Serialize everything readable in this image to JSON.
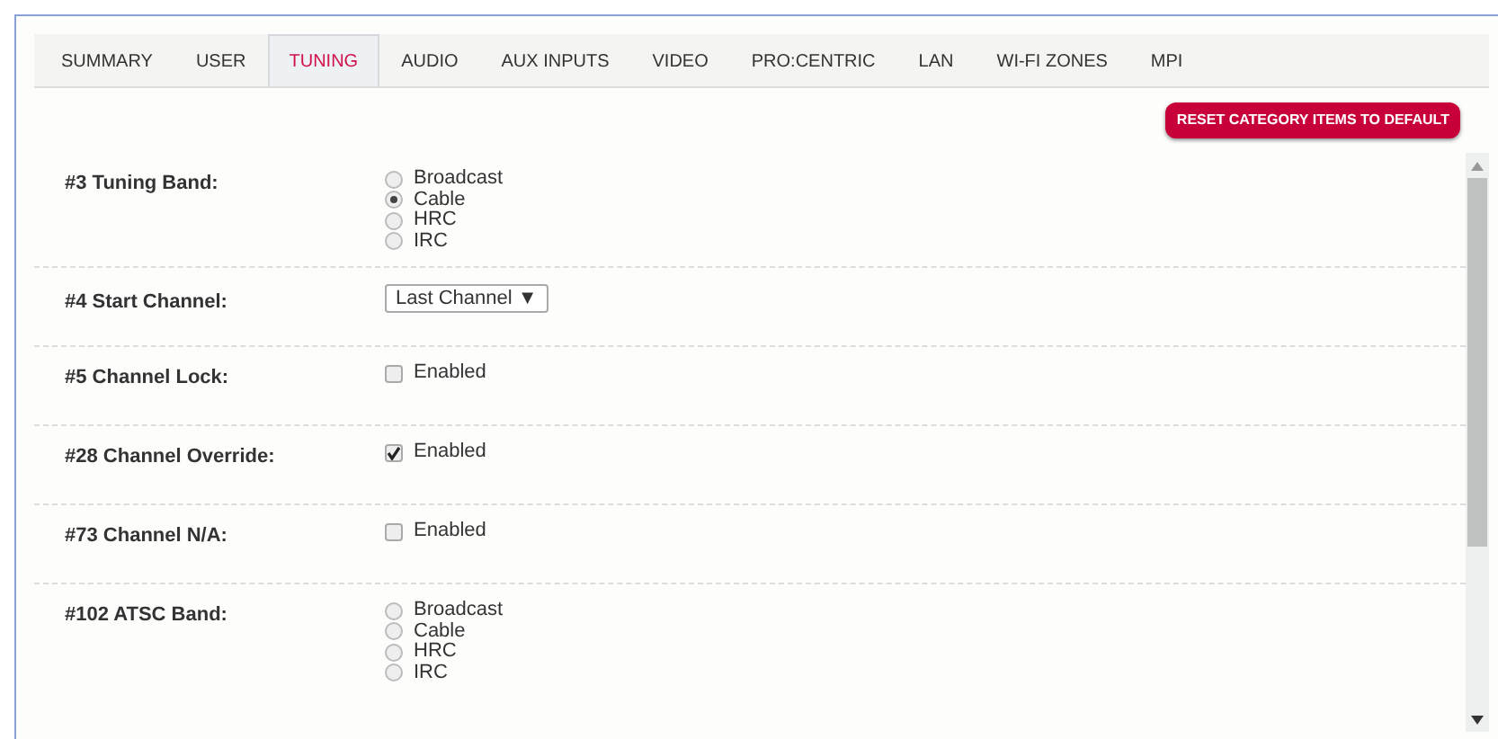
{
  "tabs": [
    {
      "label": "SUMMARY",
      "selected": false
    },
    {
      "label": "USER",
      "selected": false
    },
    {
      "label": "TUNING",
      "selected": true
    },
    {
      "label": "AUDIO",
      "selected": false
    },
    {
      "label": "AUX INPUTS",
      "selected": false
    },
    {
      "label": "VIDEO",
      "selected": false
    },
    {
      "label": "PRO:CENTRIC",
      "selected": false
    },
    {
      "label": "LAN",
      "selected": false
    },
    {
      "label": "WI-FI ZONES",
      "selected": false
    },
    {
      "label": "MPI",
      "selected": false
    }
  ],
  "reset_button": "RESET CATEGORY ITEMS TO DEFAULT",
  "settings": [
    {
      "kind": "radio",
      "label": "#3 Tuning Band:",
      "options": [
        {
          "label": "Broadcast",
          "selected": false
        },
        {
          "label": "Cable",
          "selected": true
        },
        {
          "label": "HRC",
          "selected": false
        },
        {
          "label": "IRC",
          "selected": false
        }
      ]
    },
    {
      "kind": "select",
      "label": "#4 Start Channel:",
      "value": "Last Channel ▼"
    },
    {
      "kind": "checkbox",
      "label": "#5 Channel Lock:",
      "text": "Enabled",
      "checked": false
    },
    {
      "kind": "checkbox",
      "label": "#28 Channel Override:",
      "text": "Enabled",
      "checked": true
    },
    {
      "kind": "checkbox",
      "label": "#73 Channel N/A:",
      "text": "Enabled",
      "checked": false
    },
    {
      "kind": "radio",
      "label": "#102 ATSC Band:",
      "options": [
        {
          "label": "Broadcast",
          "selected": false
        },
        {
          "label": "Cable",
          "selected": false
        },
        {
          "label": "HRC",
          "selected": false
        },
        {
          "label": "IRC",
          "selected": false
        }
      ]
    }
  ]
}
